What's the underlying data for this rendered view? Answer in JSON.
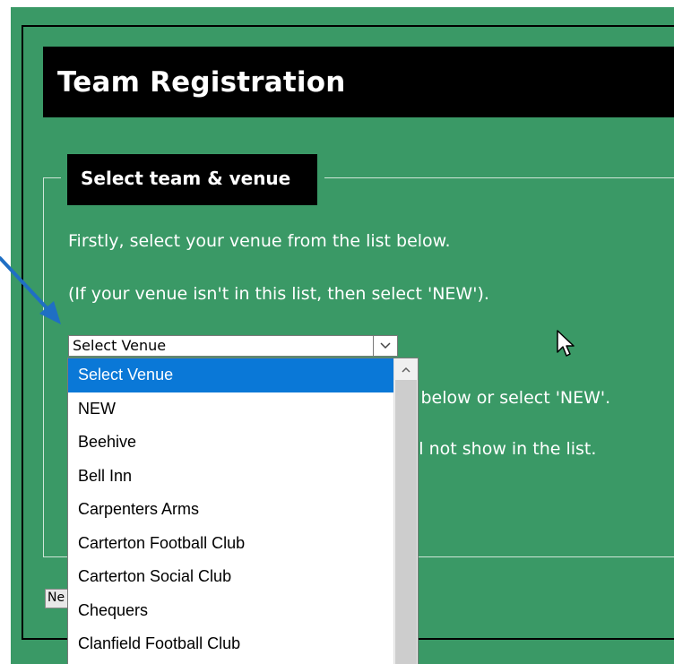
{
  "page": {
    "title": "Team Registration",
    "section_legend": "Select team & venue",
    "instruction_1": "Firstly, select your venue from the list below.",
    "instruction_2": "(If your venue isn't in this list, then select 'NEW').",
    "partial_line_1": "t below or select 'NEW'.",
    "partial_line_2": "ll not show in the list.",
    "new_button_partial": "Ne"
  },
  "venue_select": {
    "selected": "Select Venue",
    "options": [
      "Select Venue",
      "NEW",
      "Beehive",
      "Bell Inn",
      "Carpenters Arms",
      "Carterton Football Club",
      "Carterton Social Club",
      "Chequers",
      "Clanfield Football Club"
    ],
    "highlighted_index": 0
  },
  "colors": {
    "background": "#3a9966",
    "header": "#000000",
    "highlight": "#0a78d7",
    "annotation_arrow": "#1f6fc4"
  },
  "icons": {
    "dropdown": "chevron-down-icon",
    "scroll_up": "chevron-up-icon",
    "cursor": "mouse-pointer-icon",
    "annotation": "arrow-annotation-icon"
  }
}
